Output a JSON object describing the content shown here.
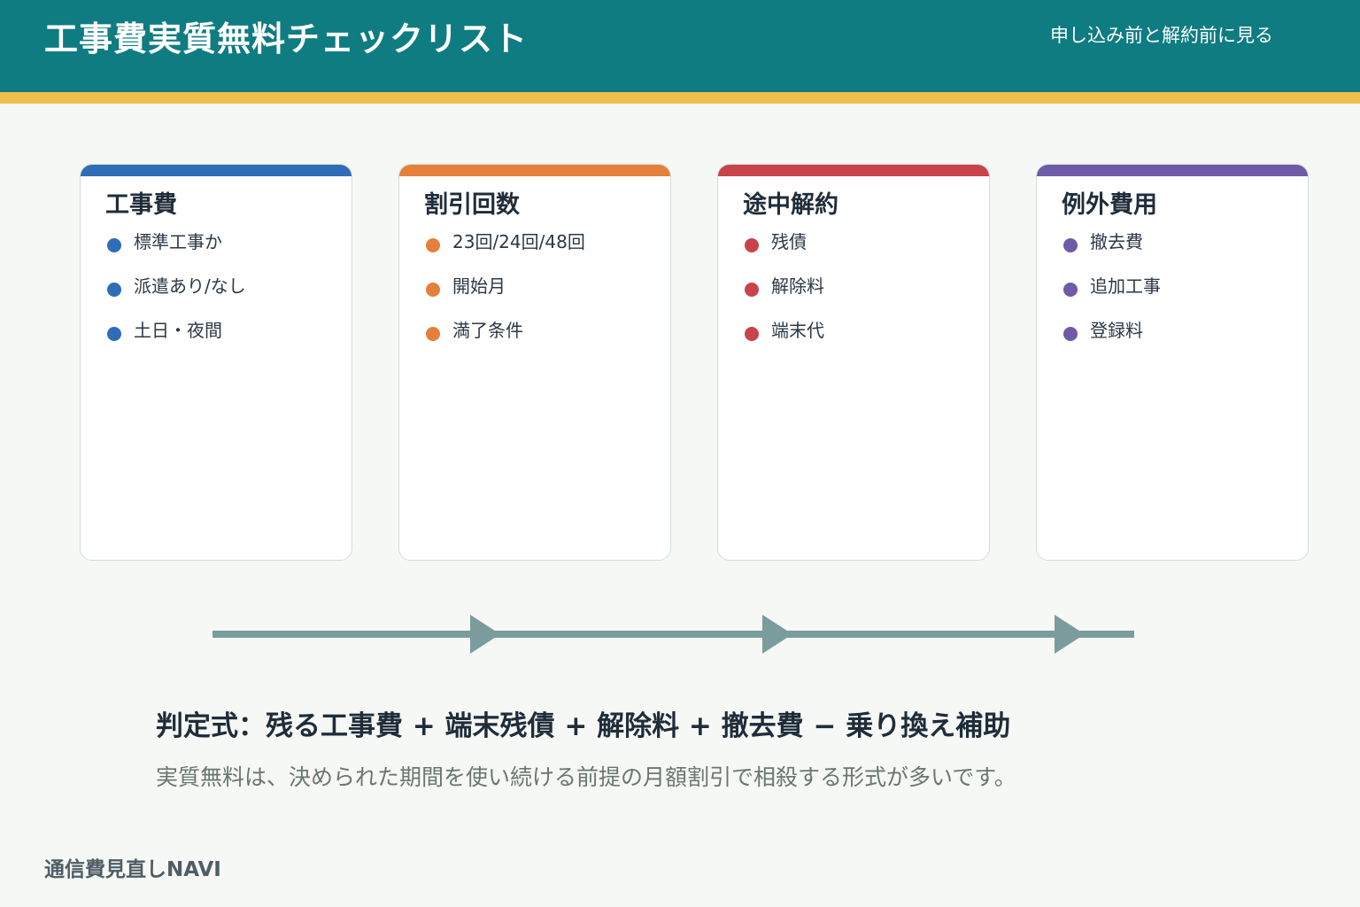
{
  "header": {
    "title": "工事費実質無料チェックリスト",
    "subtitle": "申し込み前と解約前に見る",
    "background_color": "#0f7c82",
    "stripe_color": "#f0bd4f"
  },
  "cards": [
    {
      "title": "工事費",
      "accent_color": "#2f6db8",
      "items": [
        "標準工事か",
        "派遣あり/なし",
        "土日・夜間"
      ]
    },
    {
      "title": "割引回数",
      "accent_color": "#e5803a",
      "items": [
        "23回/24回/48回",
        "開始月",
        "満了条件"
      ]
    },
    {
      "title": "途中解約",
      "accent_color": "#c9444a",
      "items": [
        "残債",
        "解除料",
        "端末代"
      ]
    },
    {
      "title": "例外費用",
      "accent_color": "#6f5aa7",
      "items": [
        "撤去費",
        "追加工事",
        "登録料"
      ]
    }
  ],
  "flow": {
    "arrow_color": "#7a9c9c",
    "arrow_count": 3
  },
  "formula": "判定式：残る工事費 + 端末残債 + 解除料 + 撤去費 − 乗り換え補助",
  "note": "実質無料は、決められた期間を使い続ける前提の月額割引で相殺する形式が多いです。",
  "brand": "通信費見直しNAVI"
}
